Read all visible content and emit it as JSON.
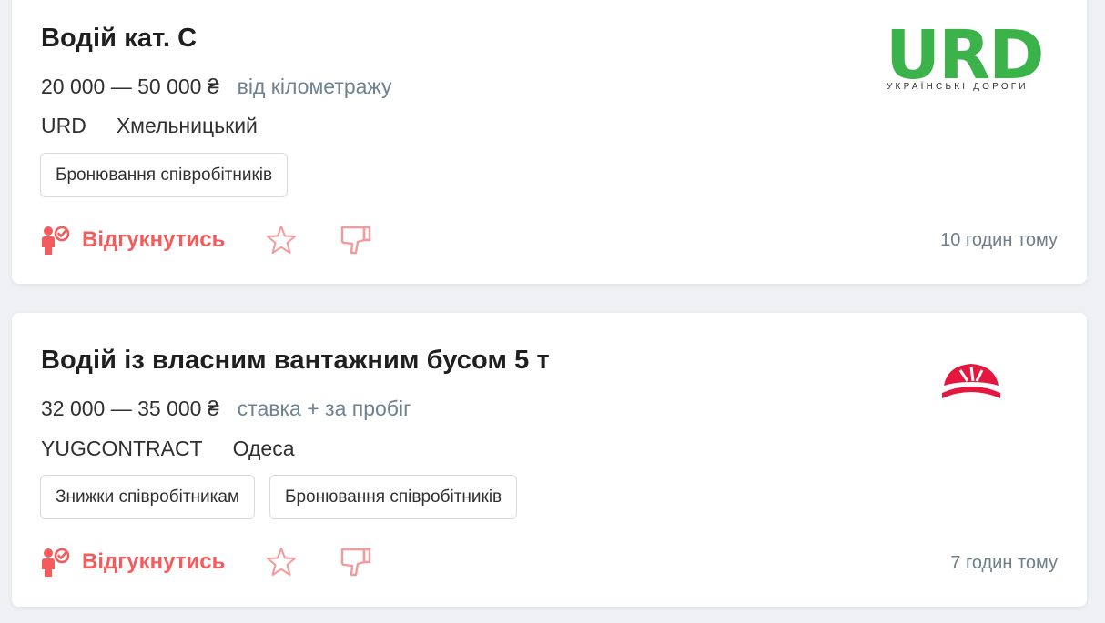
{
  "vacancies": [
    {
      "title": "Водій кат. С",
      "salary": "20 000 — 50 000 ₴",
      "salary_note": "від кілометражу",
      "company": "URD",
      "city": "Хмельницький",
      "tags": [
        "Бронювання співробітників"
      ],
      "apply_label": "Відгукнутись",
      "time": "10 годин тому",
      "logo": {
        "word": "URD",
        "subtitle": "УКРАЇНСЬКІ ДОРОГИ",
        "color": "#3bb34a"
      }
    },
    {
      "title": "Водій із власним вантажним бусом 5 т",
      "salary": "32 000 — 35 000 ₴",
      "salary_note": "ставка + за пробіг",
      "company": "YUGCONTRACT",
      "city": "Одеса",
      "tags": [
        "Знижки співробітникам",
        "Бронювання співробітників"
      ],
      "apply_label": "Відгукнутись",
      "time": "7 годин тому",
      "logo": {
        "icon": "yugcontract-logo-icon",
        "color": "#e5173f"
      }
    }
  ],
  "colors": {
    "accent": "#f25c5c",
    "muted_text": "#6f8290",
    "background": "#eef0f3"
  },
  "icons": {
    "apply": "person-check-icon",
    "favorite": "star-outline-icon",
    "dislike": "thumbs-down-icon"
  }
}
